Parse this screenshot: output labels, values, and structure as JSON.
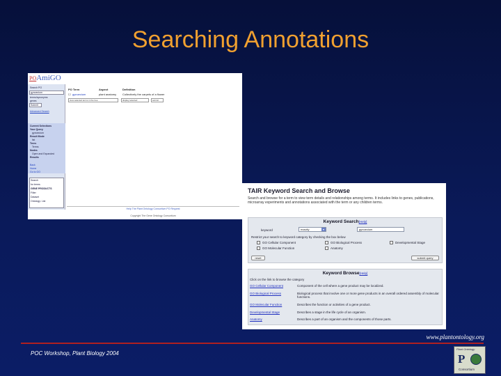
{
  "slide": {
    "title": "Searching Annotations",
    "url": "www.plantontology.org",
    "workshop": "POC Workshop, Plant Biology 2004"
  },
  "logo": {
    "top_text": "Plant Ontology",
    "mark": "P",
    "bottom_text": "Consortium"
  },
  "amigo": {
    "brand_prefix": "PO",
    "brand_name": "AmiGO",
    "side": {
      "search_label": "Search PO",
      "search_value": "gynoecium",
      "opt_terms": "terms/synonyms",
      "opt_genes": "genes",
      "submit": "Submit",
      "advanced": "Advanced Search",
      "current": "Current Selections",
      "your_query": "Your Query",
      "query_val": "gynoecium",
      "result_mode": "Result Mode",
      "list": "list",
      "trees": "Trees",
      "tree_val": "Terms",
      "nodes": "Nodes",
      "nodes_val": "Open and Expanded",
      "results": "Results",
      "link1": "Back",
      "link2": "Home",
      "link3": "Go to GO",
      "search2": "Search",
      "search2_val": "for terms",
      "datasource": "GENE PRODUCTS",
      "ds_val": "Filter",
      "ds_opt1": "Dataset",
      "ds_opt2": "Ontology: List"
    },
    "headers": {
      "term": "PO Term",
      "aspect": "Aspect",
      "definition": "Definition"
    },
    "row": {
      "term": "gynoecium",
      "aspect": "plant anatomy",
      "definition": "Collectively the carpels of a flower"
    },
    "controls": {
      "select_all": "view selected terms in the tree",
      "display": "display selected",
      "go": "submit"
    },
    "footer_links": "Help    The Plant Ontology Consortium    PO Request",
    "copyright": "Copyright The Gene Ontology Consortium"
  },
  "tair": {
    "title": "TAIR Keyword Search and Browse",
    "description": "Search and browse for a term to view term details and relationships among terms. It includes links to genes, publications, microarray experiments and annotations associated with the term or any children terms.",
    "search_panel": {
      "title": "Keyword Search",
      "help": "[Help]",
      "keyword_label": "keyword",
      "match_value": "exactly",
      "keyword_value": "gynoecium",
      "restrict_text": "Restrict your search to keyword category by checking the box below",
      "categories": [
        "GO Cellular Component",
        "GO Biological Process",
        "Developmental Stage",
        "GO Molecular Function",
        "Anatomy"
      ],
      "reset": "reset",
      "submit": "submit query"
    },
    "browse_panel": {
      "title": "Keyword Browse",
      "help": "[Help]",
      "intro": "Click on the link to browse the category",
      "items": [
        {
          "link": "GO Cellular Component",
          "desc": "Component of the cell where a gene product may be localized."
        },
        {
          "link": "GO Biological Process",
          "desc": "Biological process that involve one or more gene products in an overall ordered assembly of molecular functions."
        },
        {
          "link": "GO Molecular Function",
          "desc": "Describes the function or activities of a gene product."
        },
        {
          "link": "Developmental Stage",
          "desc": "Describes a stage in the life cycle of an organism."
        },
        {
          "link": "Anatomy",
          "desc": "Describes a part of an organism and the components of those parts."
        }
      ]
    }
  }
}
